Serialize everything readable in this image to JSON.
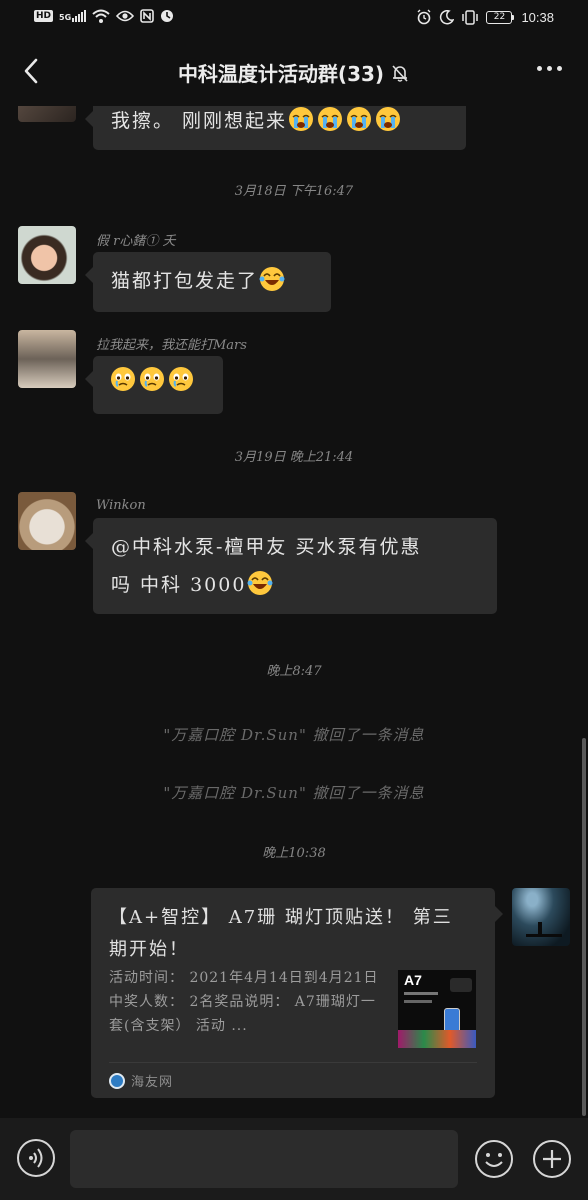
{
  "status_bar": {
    "hd_badge": "HD",
    "network": "5G",
    "battery_level": "22",
    "time": "10:38",
    "icons": [
      "hd-icon",
      "signal-icon",
      "wifi-icon",
      "eye-icon",
      "nfc-icon",
      "clock-icon",
      "alarm-icon",
      "moon-icon",
      "vibrate-icon",
      "battery-icon"
    ]
  },
  "header": {
    "title": "中科温度计活动群(33)",
    "back_icon": "back-arrow-icon",
    "mute_icon": "bell-muted-icon",
    "more_icon": "more-dots-icon"
  },
  "messages": [
    {
      "type": "text",
      "text": "我擦。 刚刚想起来",
      "emoji": [
        "crying-emoji",
        "crying-emoji",
        "crying-emoji",
        "crying-emoji"
      ]
    },
    {
      "type": "timestamp",
      "text": "3月18日 下午16:47"
    },
    {
      "type": "text",
      "sender": "假 r心鍺① 夭",
      "text": "猫都打包发走了",
      "emoji": [
        "laugh-cry-emoji"
      ]
    },
    {
      "type": "text",
      "sender": "拉我起来，我还能打Mars",
      "text": "",
      "emoji": [
        "tearful-emoji",
        "tearful-emoji",
        "tearful-emoji"
      ]
    },
    {
      "type": "timestamp",
      "text": "3月19日 晚上21:44"
    },
    {
      "type": "text",
      "sender": "Winkon",
      "line1": "@中科水泵-檀甲友  买水泵有优惠",
      "line2": "吗 中科 3000",
      "emoji": [
        "laugh-cry-emoji"
      ]
    },
    {
      "type": "timestamp",
      "text": "晚上8:47"
    },
    {
      "type": "recall",
      "text": "\"万嘉口腔 Dr.Sun\" 撤回了一条消息"
    },
    {
      "type": "recall",
      "text": "\"万嘉口腔 Dr.Sun\" 撤回了一条消息"
    },
    {
      "type": "timestamp",
      "text": "晚上10:38"
    },
    {
      "type": "card",
      "title": "【A+智控】 A7珊 瑚灯顶贴送！ 第三期开始！",
      "description": "活动时间： 2021年4月14日到4月21日中奖人数： 2名奖品说明： A7珊瑚灯一套(含支架） 活动 ...",
      "thumb_label": "A7",
      "source": "海友网"
    }
  ],
  "input_bar": {
    "placeholder": "",
    "voice_icon": "voice-icon",
    "emoji_icon": "emoji-icon",
    "plus_icon": "plus-icon"
  },
  "colors": {
    "background": "#111111",
    "bubble": "#2c2c2c",
    "text": "#e4e4e4",
    "muted": "#868686"
  }
}
